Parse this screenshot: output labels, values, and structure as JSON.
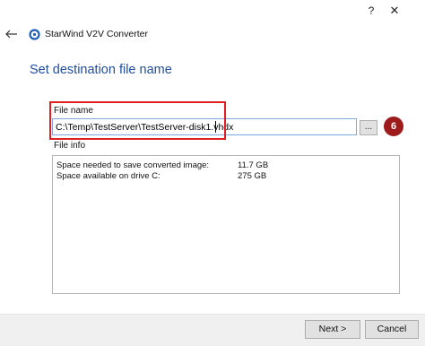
{
  "window": {
    "help_label": "?",
    "close_label": "✕"
  },
  "header": {
    "back_icon": "back-arrow-icon",
    "logo_icon": "starwind-logo-icon",
    "app_title": "StarWind V2V Converter"
  },
  "page": {
    "title": "Set destination file name"
  },
  "file_name": {
    "label": "File name",
    "value": "C:\\Temp\\TestServer\\TestServer-disk1.vhdx",
    "browse_label": "..."
  },
  "annotation": {
    "step_number": "6",
    "highlight_color": "#e02020",
    "badge_color": "#9e1b1b"
  },
  "file_info": {
    "label": "File info",
    "rows": [
      {
        "label": "Space needed to save converted image:",
        "value": "11.7 GB"
      },
      {
        "label": "Space available on drive C:",
        "value": "275 GB"
      }
    ]
  },
  "footer": {
    "next_label": "Next >",
    "cancel_label": "Cancel"
  },
  "colors": {
    "title_color": "#1f4e9e",
    "input_border_focus": "#7aa7e0"
  }
}
